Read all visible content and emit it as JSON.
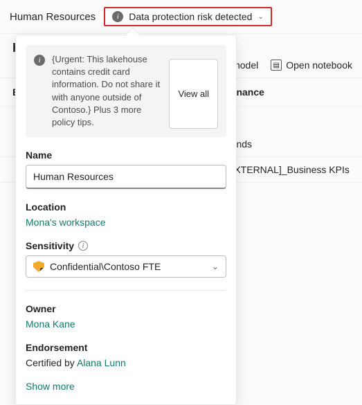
{
  "header": {
    "page_title": "Human Resources",
    "risk_label": "Data protection risk detected"
  },
  "subheading_letter": "H",
  "toolbar": {
    "model_label": "model",
    "open_notebook_label": "Open notebook"
  },
  "columns": {
    "e_letter": "E",
    "finance_label": "Finance",
    "row1_right": "rends",
    "row2_right": "EXTERNAL]_Business KPIs"
  },
  "popover": {
    "notice_text": "{Urgent: This lakehouse contains credit card information. Do not share it with anyone outside of Contoso.} Plus 3 more policy tips.",
    "view_all_label": "View all",
    "name_label": "Name",
    "name_value": "Human Resources",
    "location_label": "Location",
    "location_value": "Mona's workspace",
    "sensitivity_label": "Sensitivity",
    "sensitivity_value": "Confidential\\Contoso FTE",
    "owner_label": "Owner",
    "owner_value": "Mona Kane",
    "endorsement_label": "Endorsement",
    "endorsement_prefix": "Certified by ",
    "endorsement_person": "Alana Lunn",
    "show_more_label": "Show more"
  }
}
